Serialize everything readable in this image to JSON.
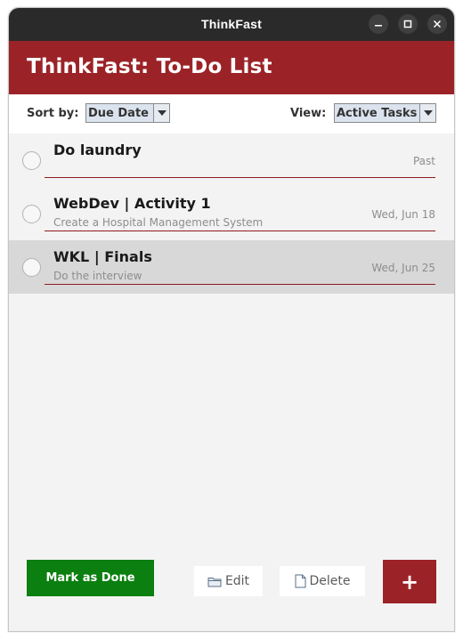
{
  "window": {
    "title": "ThinkFast",
    "controls": {
      "minimize_icon": "minimize-icon",
      "maximize_icon": "maximize-icon",
      "close_icon": "close-icon"
    }
  },
  "header": {
    "title": "ThinkFast: To-Do List",
    "background": "#9b2327"
  },
  "toolbar": {
    "sort_label": "Sort by:",
    "sort_value": "Due Date",
    "view_label": "View:",
    "view_value": "Active Tasks"
  },
  "tasks": [
    {
      "title": "Do laundry",
      "description": "",
      "date": "Past",
      "selected": false
    },
    {
      "title": "WebDev | Activity 1",
      "description": "Create a Hospital Management System",
      "date": "Wed, Jun 18",
      "selected": false
    },
    {
      "title": "WKL | Finals",
      "description": "Do the interview",
      "date": "Wed, Jun 25",
      "selected": true
    }
  ],
  "actions": {
    "mark_done_label": "Mark as Done",
    "edit_label": "Edit",
    "delete_label": "Delete",
    "add_label": "+"
  },
  "colors": {
    "accent": "#9b2327",
    "done_button": "#0b7f0f",
    "titlebar": "#2a2a2a",
    "divider": "#8e1b1f"
  }
}
